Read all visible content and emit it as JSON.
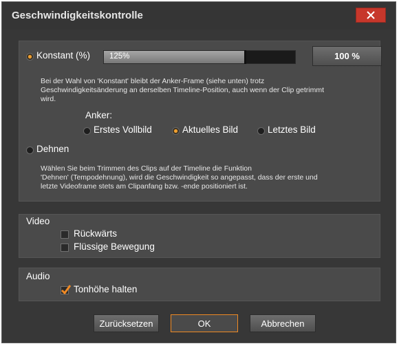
{
  "window": {
    "title": "Geschwindigkeitskontrolle",
    "close_icon": "close-icon"
  },
  "speed": {
    "constant_label": "Konstant (%)",
    "constant_selected": true,
    "slider_value_text": "125%",
    "slider_value": 125,
    "reset_100_label": "100 %",
    "constant_description": [
      "Bei der Wahl von 'Konstant' bleibt der Anker-Frame (siehe unten) trotz",
      "Geschwindigkeitsänderung an derselben Timeline-Position, auch wenn der Clip getrimmt",
      "wird."
    ],
    "anchor_label": "Anker:",
    "anchor_options": [
      {
        "label": "Erstes Vollbild",
        "selected": false
      },
      {
        "label": "Aktuelles Bild",
        "selected": true
      },
      {
        "label": "Letztes Bild",
        "selected": false
      }
    ],
    "stretch_label": "Dehnen",
    "stretch_selected": false,
    "stretch_description": [
      "Wählen Sie beim Trimmen des Clips auf der Timeline die Funktion",
      "'Dehnen' (Tempodehnung),  wird die Geschwindigkeit so angepasst,  dass der erste und",
      "letzte Videoframe stets am Clipanfang bzw. -ende positioniert ist."
    ]
  },
  "video": {
    "heading": "Video",
    "reverse_label": "Rückwärts",
    "reverse_checked": false,
    "smooth_label": "Flüssige Bewegung",
    "smooth_checked": false
  },
  "audio": {
    "heading": "Audio",
    "pitch_label": "Tonhöhe halten",
    "pitch_checked": true
  },
  "buttons": {
    "reset_label": "Zurücksetzen",
    "ok_label": "OK",
    "cancel_label": "Abbrechen"
  },
  "colors": {
    "accent": "#f08a24",
    "close": "#c7372b",
    "background": "#373737",
    "panel": "#4a4a4a"
  }
}
